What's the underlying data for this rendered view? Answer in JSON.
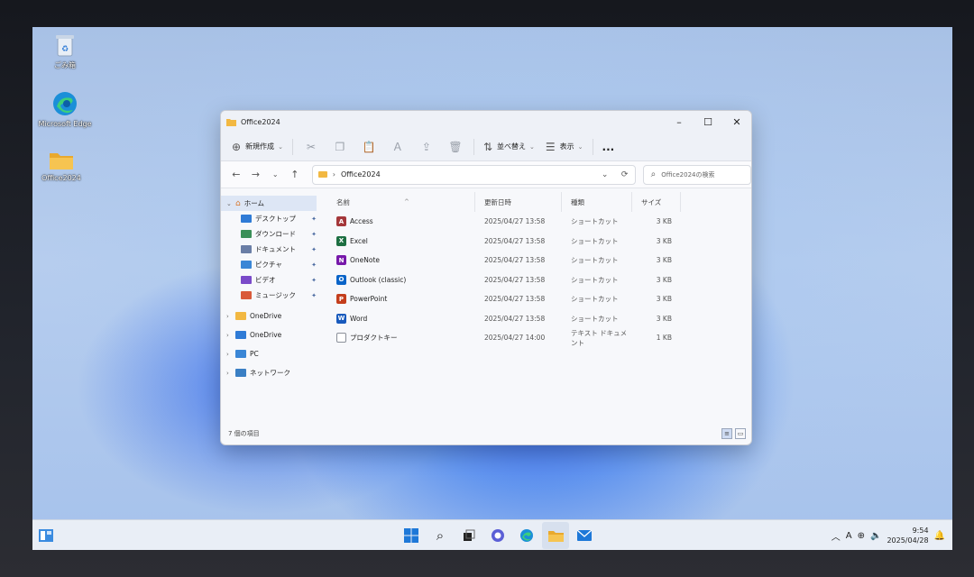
{
  "desktop": {
    "icons": [
      {
        "label": "ごみ箱",
        "icon": "recycle-bin-icon"
      },
      {
        "label": "Microsoft Edge",
        "icon": "edge-icon"
      },
      {
        "label": "Office2024",
        "icon": "folder-icon"
      }
    ]
  },
  "window": {
    "title": "Office2024",
    "toolbar": {
      "new_label": "新規作成",
      "sort_label": "並べ替え",
      "view_label": "表示",
      "more_label": "..."
    },
    "address": {
      "path": "Office2024"
    },
    "search": {
      "placeholder": "Office2024の検索"
    },
    "sidebar": {
      "home": "ホーム",
      "quick": [
        {
          "label": "デスクトップ",
          "color": "#2f7bd6"
        },
        {
          "label": "ダウンロード",
          "color": "#3a8f58"
        },
        {
          "label": "ドキュメント",
          "color": "#6a7ea6"
        },
        {
          "label": "ピクチャ",
          "color": "#3a86d6"
        },
        {
          "label": "ビデオ",
          "color": "#7a4ac9"
        },
        {
          "label": "ミュージック",
          "color": "#d95a3a"
        }
      ],
      "roots": [
        {
          "label": "OneDrive",
          "color": "#f2b842"
        },
        {
          "label": "OneDrive",
          "color": "#2f7bd6"
        },
        {
          "label": "PC",
          "color": "#3a86d6"
        },
        {
          "label": "ネットワーク",
          "color": "#3a7fc4"
        }
      ]
    },
    "columns": {
      "name": "名前",
      "date": "更新日時",
      "type": "種類",
      "size": "サイズ"
    },
    "files": [
      {
        "name": "Access",
        "date": "2025/04/27 13:58",
        "type": "ショートカット",
        "size": "3 KB",
        "color": "#a4373a",
        "letter": "A"
      },
      {
        "name": "Excel",
        "date": "2025/04/27 13:58",
        "type": "ショートカット",
        "size": "3 KB",
        "color": "#1d6f42",
        "letter": "X"
      },
      {
        "name": "OneNote",
        "date": "2025/04/27 13:58",
        "type": "ショートカット",
        "size": "3 KB",
        "color": "#7719aa",
        "letter": "N"
      },
      {
        "name": "Outlook (classic)",
        "date": "2025/04/27 13:58",
        "type": "ショートカット",
        "size": "3 KB",
        "color": "#0a64c8",
        "letter": "O"
      },
      {
        "name": "PowerPoint",
        "date": "2025/04/27 13:58",
        "type": "ショートカット",
        "size": "3 KB",
        "color": "#c43e1c",
        "letter": "P"
      },
      {
        "name": "Word",
        "date": "2025/04/27 13:58",
        "type": "ショートカット",
        "size": "3 KB",
        "color": "#185abd",
        "letter": "W"
      },
      {
        "name": "プロダクトキー",
        "date": "2025/04/27 14:00",
        "type": "テキスト ドキュメント",
        "size": "1 KB",
        "color": "#8a8f99",
        "letter": ""
      }
    ],
    "status": "7 個の項目"
  },
  "taskbar": {
    "time": "9:54",
    "date": "2025/04/28",
    "ime": "A"
  }
}
